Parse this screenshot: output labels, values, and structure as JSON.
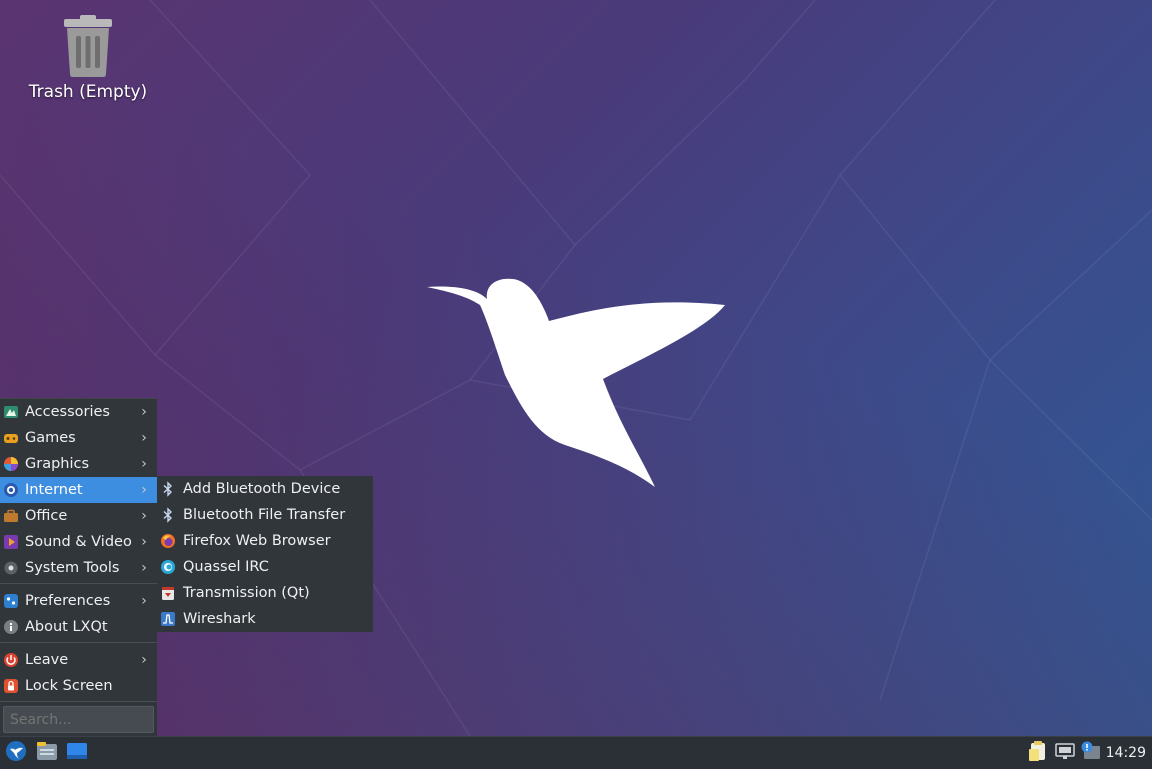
{
  "desktop": {
    "icons": [
      {
        "label": "Trash (Empty)",
        "icon": "trash-icon"
      }
    ]
  },
  "main_menu": {
    "items": [
      {
        "label": "Accessories",
        "icon": "accessories-icon",
        "has_submenu": true
      },
      {
        "label": "Games",
        "icon": "games-icon",
        "has_submenu": true
      },
      {
        "label": "Graphics",
        "icon": "graphics-icon",
        "has_submenu": true
      },
      {
        "label": "Internet",
        "icon": "internet-icon",
        "has_submenu": true,
        "active": true
      },
      {
        "label": "Office",
        "icon": "office-icon",
        "has_submenu": true
      },
      {
        "label": "Sound & Video",
        "icon": "sound-video-icon",
        "has_submenu": true
      },
      {
        "label": "System Tools",
        "icon": "system-tools-icon",
        "has_submenu": true
      },
      {
        "label": "Preferences",
        "icon": "preferences-icon",
        "has_submenu": true
      },
      {
        "label": "About LXQt",
        "icon": "info-icon",
        "has_submenu": false
      },
      {
        "label": "Leave",
        "icon": "power-icon",
        "has_submenu": true
      },
      {
        "label": "Lock Screen",
        "icon": "lock-icon",
        "has_submenu": false
      }
    ],
    "search_placeholder": "Search..."
  },
  "internet_submenu": {
    "items": [
      {
        "label": "Add Bluetooth Device",
        "icon": "bluetooth-icon"
      },
      {
        "label": "Bluetooth File Transfer",
        "icon": "bluetooth-icon"
      },
      {
        "label": "Firefox Web Browser",
        "icon": "firefox-icon"
      },
      {
        "label": "Quassel IRC",
        "icon": "quassel-icon"
      },
      {
        "label": "Transmission (Qt)",
        "icon": "transmission-icon"
      },
      {
        "label": "Wireshark",
        "icon": "wireshark-icon"
      }
    ]
  },
  "taskbar": {
    "left_buttons": [
      "start-menu-icon",
      "file-manager-icon",
      "show-desktop-icon"
    ],
    "tray_icons": [
      "clipboard-icon",
      "network-icon",
      "update-notifier-icon"
    ],
    "clock": "14:29"
  },
  "colors": {
    "menu_bg": "#31363b",
    "menu_highlight": "#3d8ee0",
    "taskbar_bg": "#2b3036"
  }
}
